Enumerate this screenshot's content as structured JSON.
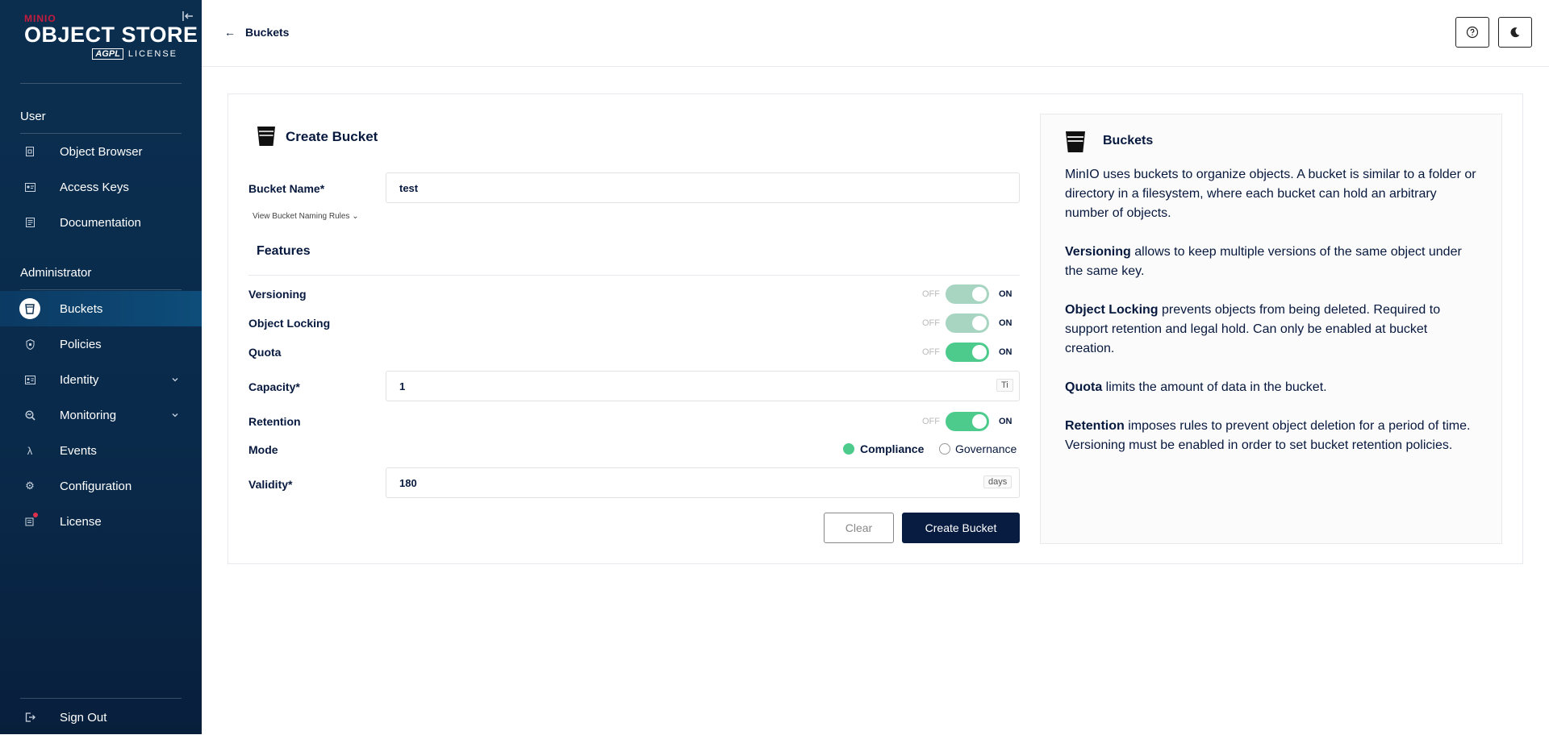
{
  "brand": {
    "minio": "MINIO",
    "product": "OBJECT STORE",
    "agpl": "AGPL",
    "license": "LICENSE"
  },
  "sidebar": {
    "user_section": "User",
    "admin_section": "Administrator",
    "items": [
      {
        "label": "Object Browser",
        "icon": "object-browser-icon"
      },
      {
        "label": "Access Keys",
        "icon": "access-keys-icon"
      },
      {
        "label": "Documentation",
        "icon": "documentation-icon"
      },
      {
        "label": "Buckets",
        "icon": "bucket-icon"
      },
      {
        "label": "Policies",
        "icon": "policies-icon"
      },
      {
        "label": "Identity",
        "icon": "identity-icon"
      },
      {
        "label": "Monitoring",
        "icon": "monitoring-icon"
      },
      {
        "label": "Events",
        "icon": "lambda-icon"
      },
      {
        "label": "Configuration",
        "icon": "gear-icon"
      },
      {
        "label": "License",
        "icon": "license-icon"
      },
      {
        "label": "Sign Out",
        "icon": "sign-out-icon"
      }
    ]
  },
  "header": {
    "back_label": "Buckets"
  },
  "form": {
    "title": "Create Bucket",
    "bucket_name_label": "Bucket Name*",
    "bucket_name_value": "test",
    "naming_rules": "View Bucket Naming Rules",
    "features_title": "Features",
    "off": "OFF",
    "on": "ON",
    "versioning_label": "Versioning",
    "object_locking_label": "Object Locking",
    "quota_label": "Quota",
    "capacity_label": "Capacity*",
    "capacity_value": "1",
    "capacity_unit": "Ti",
    "retention_label": "Retention",
    "mode_label": "Mode",
    "mode_compliance": "Compliance",
    "mode_governance": "Governance",
    "validity_label": "Validity*",
    "validity_value": "180",
    "validity_unit": "days",
    "clear_button": "Clear",
    "create_button": "Create Bucket"
  },
  "help": {
    "title": "Buckets",
    "intro": "MinIO uses buckets to organize objects. A bucket is similar to a folder or directory in a filesystem, where each bucket can hold an arbitrary number of objects.",
    "versioning_term": "Versioning",
    "versioning_text": " allows to keep multiple versions of the same object under the same key.",
    "locking_term": "Object Locking",
    "locking_text": " prevents objects from being deleted. Required to support retention and legal hold. Can only be enabled at bucket creation.",
    "quota_term": "Quota",
    "quota_text": " limits the amount of data in the bucket.",
    "retention_term": "Retention",
    "retention_text": " imposes rules to prevent object deletion for a period of time. Versioning must be enabled in order to set bucket retention policies."
  },
  "colors": {
    "sidebar": "#0b2e4f",
    "accent": "#4ccb8d",
    "accent_disabled": "#a8d5c1",
    "primary_button": "#081c42",
    "text": "#07193e"
  }
}
